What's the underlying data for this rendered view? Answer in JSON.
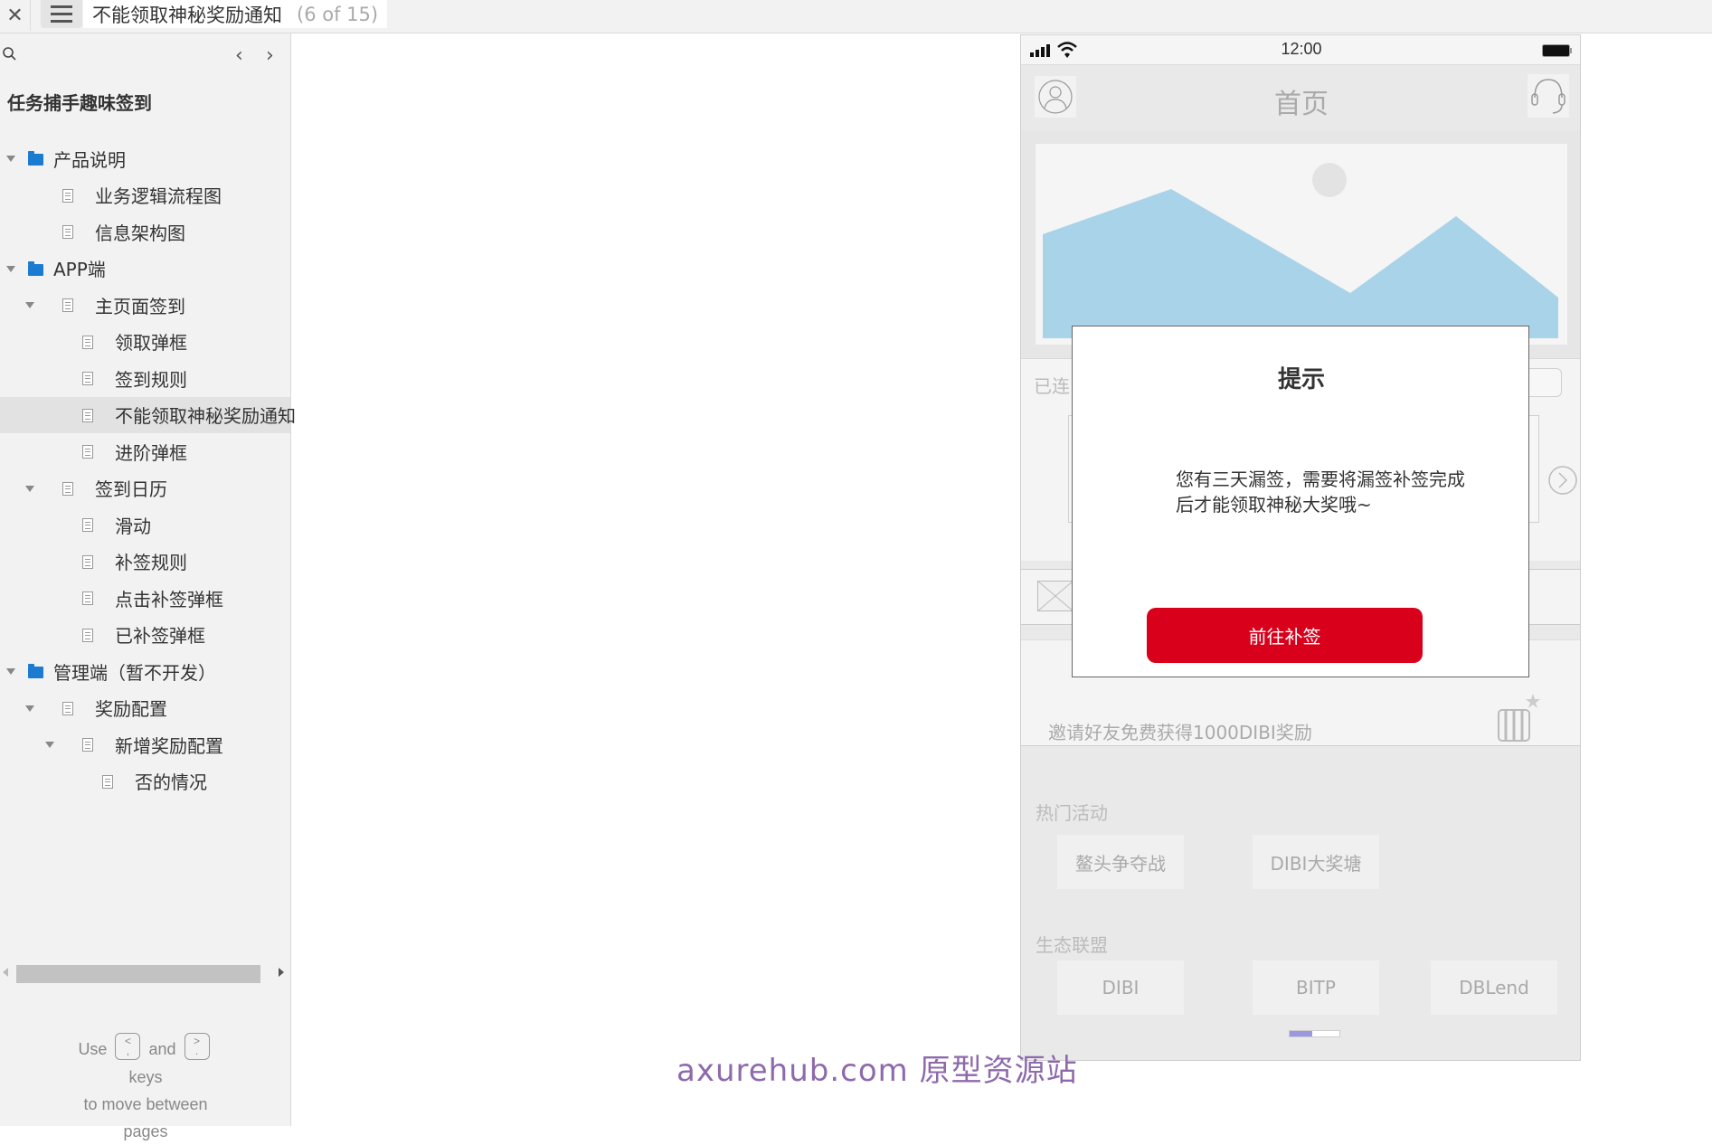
{
  "topbar": {
    "close_icon": "close-icon",
    "menu_icon": "hamburger-menu-icon",
    "page_title": "不能领取神秘奖励通知",
    "page_count": "(6 of 15)"
  },
  "sidebar": {
    "search_icon": "search-icon",
    "prev_label": "‹",
    "next_label": "›",
    "project_title": "任务捕手趣味签到",
    "tree": [
      {
        "label": "产品说明",
        "type": "folder",
        "level": 0,
        "expanded": true
      },
      {
        "label": "业务逻辑流程图",
        "type": "page",
        "level": 1
      },
      {
        "label": "信息架构图",
        "type": "page",
        "level": 1
      },
      {
        "label": "APP端",
        "type": "folder",
        "level": 0,
        "expanded": true
      },
      {
        "label": "主页面签到",
        "type": "page",
        "level": 1,
        "expanded": true
      },
      {
        "label": "领取弹框",
        "type": "page",
        "level": 2
      },
      {
        "label": "签到规则",
        "type": "page",
        "level": 2
      },
      {
        "label": "不能领取神秘奖励通知",
        "type": "page",
        "level": 2,
        "selected": true
      },
      {
        "label": "进阶弹框",
        "type": "page",
        "level": 2
      },
      {
        "label": "签到日历",
        "type": "page",
        "level": 1,
        "expanded": true
      },
      {
        "label": "滑动",
        "type": "page",
        "level": 2
      },
      {
        "label": "补签规则",
        "type": "page",
        "level": 2
      },
      {
        "label": "点击补签弹框",
        "type": "page",
        "level": 2
      },
      {
        "label": "已补签弹框",
        "type": "page",
        "level": 2
      },
      {
        "label": "管理端（暂不开发）",
        "type": "folder",
        "level": 0,
        "expanded": true
      },
      {
        "label": "奖励配置",
        "type": "page",
        "level": 1,
        "expanded": true
      },
      {
        "label": "新增奖励配置",
        "type": "page",
        "level": 2,
        "expanded": true
      },
      {
        "label": "否的情况",
        "type": "page",
        "level": 3
      }
    ],
    "hint": {
      "use": "Use",
      "prev_key_top": "<",
      "prev_key_bottom": ",",
      "and": "and",
      "next_key_top": ">",
      "next_key_bottom": ".",
      "keys": "keys",
      "line2": "to move between",
      "line3": "pages"
    }
  },
  "phone": {
    "status_bar": {
      "time": "12:00"
    },
    "header": {
      "title": "首页",
      "left_icon": "user-avatar-icon",
      "right_icon": "headset-icon"
    },
    "banner": {
      "slide_count": 3,
      "active_slide": 1
    },
    "streak_label": "已连",
    "invite_text": "邀请好友免费获得1000DIBI奖励",
    "hot_activities": {
      "title": "热门活动",
      "items": [
        "鳌头争夺战",
        "DIBI大奖塘"
      ]
    },
    "ecosystem": {
      "title": "生态联盟",
      "items": [
        "DIBI",
        "BITP",
        "DBLend"
      ]
    },
    "pager_progress": 0.45
  },
  "modal": {
    "title": "提示",
    "body": "您有三天漏签，需要将漏签补签完成后才能领取神秘大奖哦~",
    "button_label": "前往补签",
    "button_color": "#d9001b"
  },
  "watermark": "axurehub.com 原型资源站"
}
